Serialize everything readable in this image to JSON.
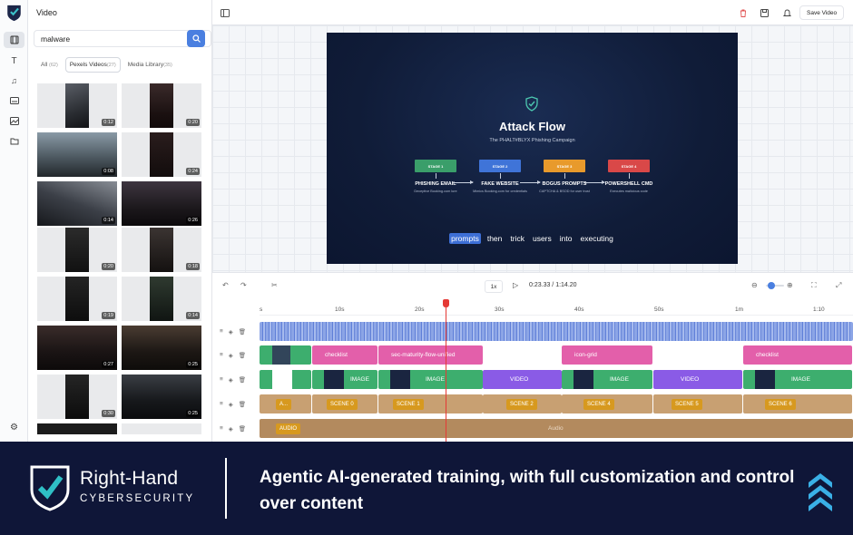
{
  "panel": {
    "title": "Video",
    "search": {
      "value": "malware",
      "placeholder": "Search"
    },
    "tabs": [
      {
        "label": "All",
        "count": "(62)"
      },
      {
        "label": "Pexels Videos",
        "count": "(27)"
      },
      {
        "label": "Media Library",
        "count": "(35)"
      }
    ],
    "active_tab": "Pexels Videos",
    "videos": [
      {
        "duration": "0:12"
      },
      {
        "duration": "0:20"
      },
      {
        "duration": "0:08"
      },
      {
        "duration": "0:24"
      },
      {
        "duration": "0:14"
      },
      {
        "duration": "0:26"
      },
      {
        "duration": "0:20"
      },
      {
        "duration": "0:18"
      },
      {
        "duration": "0:19"
      },
      {
        "duration": "0:14"
      },
      {
        "duration": "0:27"
      },
      {
        "duration": "0:25"
      },
      {
        "duration": "0:30"
      },
      {
        "duration": "0:25"
      }
    ]
  },
  "toolbar": {
    "save_label": "Save Video"
  },
  "slide": {
    "title": "Attack Flow",
    "subtitle": "The PHALT#BLYX Phishing Campaign",
    "stages": [
      {
        "tag": "STAGE 1",
        "title": "PHISHING EMAIL",
        "desc": "Deceptive Booking.com lure",
        "color": "#3a9e6a"
      },
      {
        "tag": "STAGE 2",
        "title": "FAKE WEBSITE",
        "desc": "Mimics Booking.com for credentials",
        "color": "#3f74d8"
      },
      {
        "tag": "STAGE 3",
        "title": "BOGUS PROMPTS",
        "desc": "CAPTCHA & BSOD for user trust",
        "color": "#e89a2c"
      },
      {
        "tag": "STAGE 4",
        "title": "POWERSHELL CMD",
        "desc": "Executes malicious code",
        "color": "#d94848"
      }
    ],
    "caption_words": [
      "prompts",
      "then",
      "trick",
      "users",
      "into",
      "executing"
    ],
    "caption_highlight": "prompts"
  },
  "transport": {
    "speed": "1x",
    "timecode": "0:23.33 / 1:14.20"
  },
  "timeline": {
    "ruler_labels": [
      "s",
      "10s",
      "20s",
      "30s",
      "40s",
      "50s",
      "1m",
      "1:10"
    ],
    "playhead_time": "0:23.33",
    "overlay_clips": [
      "checklist",
      "sec-maturity-flow-unified",
      "icon-grid",
      "checklist"
    ],
    "media_clips": [
      "IMAGE",
      "IMAGE",
      "VIDEO",
      "IMAGE",
      "VIDEO",
      "IMAGE"
    ],
    "scene_clips": [
      "A...",
      "SCENE 0",
      "SCENE 1",
      "SCENE 2",
      "SCENE 4",
      "SCENE 5",
      "SCENE 6"
    ],
    "audio_tag": "AUDIO",
    "audio_label": "Audio"
  },
  "banner": {
    "brand_name": "Right-Hand",
    "brand_sub": "CYBERSECURITY",
    "tagline": "Agentic AI-generated training, with full customization and control over content"
  },
  "colors": {
    "accent": "#4a7fe0",
    "banner_bg": "#0f1638",
    "playhead": "#e53935"
  }
}
